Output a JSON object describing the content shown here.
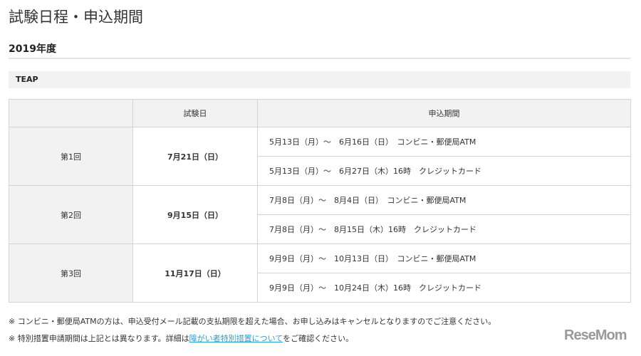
{
  "title": "試験日程・申込期間",
  "year": "2019年度",
  "section": "TEAP",
  "table": {
    "headers": [
      "",
      "試験日",
      "申込期間"
    ],
    "rows": [
      {
        "round": "第1回",
        "date": "7月21日（日）",
        "periods": [
          "5月13日（月）～　6月16日（日）　コンビニ・郵便局ATM",
          "5月13日（月）～　6月27日（木）16時　クレジットカード"
        ]
      },
      {
        "round": "第2回",
        "date": "9月15日（日）",
        "periods": [
          "7月8日（月）～　8月4日（日）　コンビニ・郵便局ATM",
          "7月8日（月）～　8月15日（木）16時　クレジットカード"
        ]
      },
      {
        "round": "第3回",
        "date": "11月17日（日）",
        "periods": [
          "9月9日（月）～　10月13日（日）　コンビニ・郵便局ATM",
          "9月9日（月）～　10月24日（木）16時　クレジットカード"
        ]
      }
    ]
  },
  "notes": {
    "note1": "※ コンビニ・郵便局ATMの方は、申込受付メール記載の支払期限を超えた場合、お申し込みはキャンセルとなりますのでご注意ください。",
    "note2_pre": "※ 特別措置申請期間は上記とは異なります。詳細は",
    "note2_link": "障がい者特別措置について",
    "note2_post": "をご確認ください。"
  },
  "logo": "ReseMom"
}
